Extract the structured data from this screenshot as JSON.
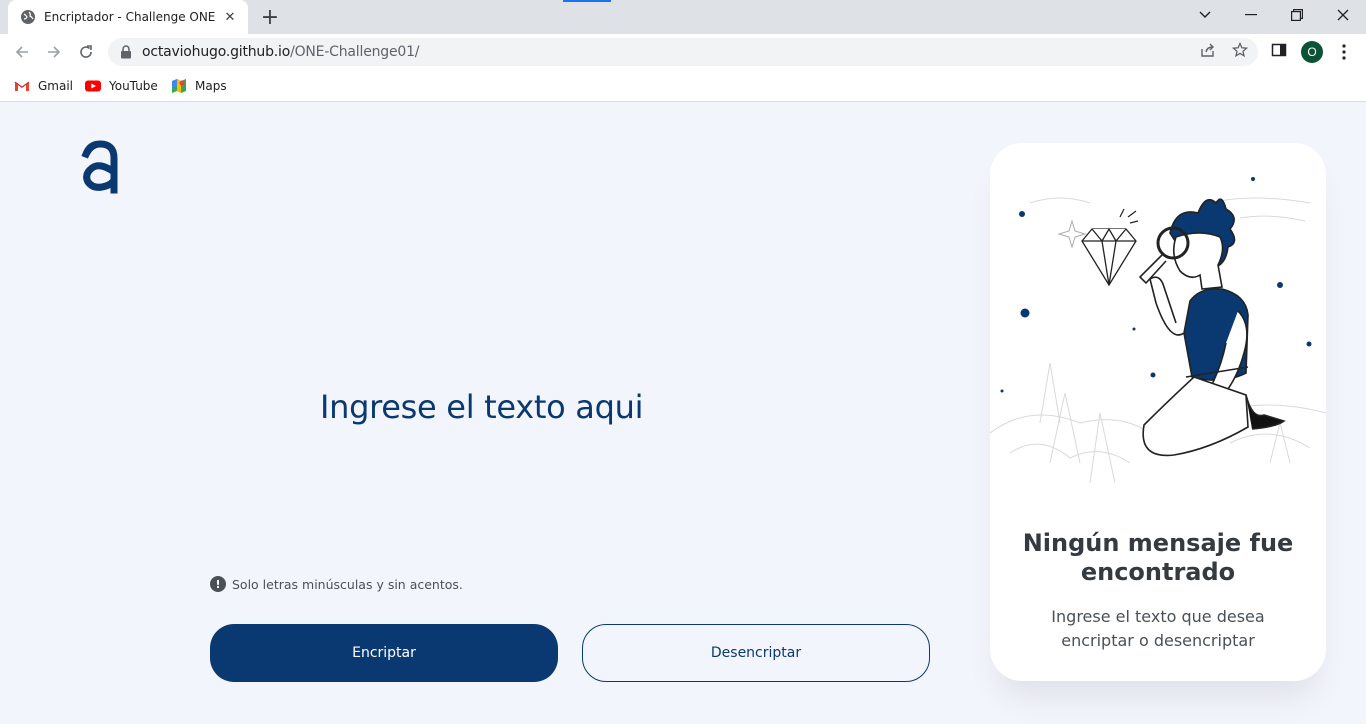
{
  "browser": {
    "tab_title": "Encriptador - Challenge ONE",
    "url_host": "octaviohugo.github.io",
    "url_path": "/ONE-Challenge01/",
    "profile_initial": "O",
    "bookmarks": [
      {
        "label": "Gmail",
        "icon": "gmail-icon"
      },
      {
        "label": "YouTube",
        "icon": "youtube-icon"
      },
      {
        "label": "Maps",
        "icon": "maps-icon"
      }
    ]
  },
  "page": {
    "input_placeholder": "Ingrese el texto aqui",
    "hint": "Solo letras minúsculas y sin acentos.",
    "encrypt_label": "Encriptar",
    "decrypt_label": "Desencriptar"
  },
  "result": {
    "title": "Ningún mensaje fue encontrado",
    "subtitle": "Ingrese el texto que desea encriptar o desencriptar"
  },
  "colors": {
    "primary": "#0a3871",
    "background": "#f3f5fc",
    "card": "#ffffff"
  }
}
